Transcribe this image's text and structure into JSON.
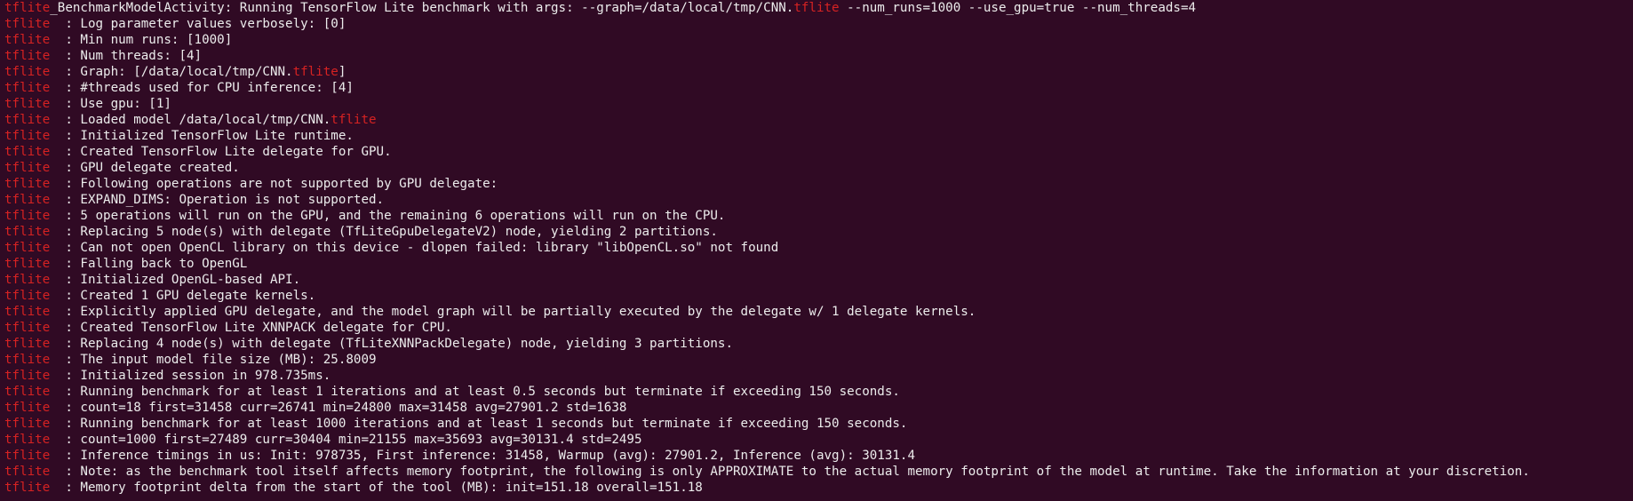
{
  "terminal": {
    "tag": "tflite",
    "first_line": {
      "tag": "tflite",
      "text": "_BenchmarkModelActivity: Running TensorFlow Lite benchmark with args: --graph=/data/local/tmp/CNN.",
      "tag_mid": "tflite",
      "tail": " --num_runs=1000 --use_gpu=true --num_threads=4"
    },
    "lines": [
      {
        "text": "  : Log parameter values verbosely: [0]"
      },
      {
        "text": "  : Min num runs: [1000]"
      },
      {
        "text": "  : Num threads: [4]"
      },
      {
        "text": "  : Graph: [/data/local/tmp/CNN.",
        "mid": "tflite",
        "tail": "]"
      },
      {
        "text": "  : #threads used for CPU inference: [4]"
      },
      {
        "text": "  : Use gpu: [1]"
      },
      {
        "text": "  : Loaded model /data/local/tmp/CNN.",
        "mid": "tflite",
        "tail": ""
      },
      {
        "text": "  : Initialized TensorFlow Lite runtime."
      },
      {
        "text": "  : Created TensorFlow Lite delegate for GPU."
      },
      {
        "text": "  : GPU delegate created."
      },
      {
        "text": "  : Following operations are not supported by GPU delegate:"
      },
      {
        "text": "  : EXPAND_DIMS: Operation is not supported."
      },
      {
        "text": "  : 5 operations will run on the GPU, and the remaining 6 operations will run on the CPU."
      },
      {
        "text": "  : Replacing 5 node(s) with delegate (TfLiteGpuDelegateV2) node, yielding 2 partitions."
      },
      {
        "text": "  : Can not open OpenCL library on this device - dlopen failed: library \"libOpenCL.so\" not found"
      },
      {
        "text": "  : Falling back to OpenGL"
      },
      {
        "text": "  : Initialized OpenGL-based API."
      },
      {
        "text": "  : Created 1 GPU delegate kernels."
      },
      {
        "text": "  : Explicitly applied GPU delegate, and the model graph will be partially executed by the delegate w/ 1 delegate kernels."
      },
      {
        "text": "  : Created TensorFlow Lite XNNPACK delegate for CPU."
      },
      {
        "text": "  : Replacing 4 node(s) with delegate (TfLiteXNNPackDelegate) node, yielding 3 partitions."
      },
      {
        "text": "  : The input model file size (MB): 25.8009"
      },
      {
        "text": "  : Initialized session in 978.735ms."
      },
      {
        "text": "  : Running benchmark for at least 1 iterations and at least 0.5 seconds but terminate if exceeding 150 seconds."
      },
      {
        "text": "  : count=18 first=31458 curr=26741 min=24800 max=31458 avg=27901.2 std=1638"
      },
      {
        "text": "  : Running benchmark for at least 1000 iterations and at least 1 seconds but terminate if exceeding 150 seconds."
      },
      {
        "text": "  : count=1000 first=27489 curr=30404 min=21155 max=35693 avg=30131.4 std=2495"
      },
      {
        "text": "  : Inference timings in us: Init: 978735, First inference: 31458, Warmup (avg): 27901.2, Inference (avg): 30131.4"
      },
      {
        "text": "  : Note: as the benchmark tool itself affects memory footprint, the following is only APPROXIMATE to the actual memory footprint of the model at runtime. Take the information at your discretion."
      },
      {
        "text": "  : Memory footprint delta from the start of the tool (MB): init=151.18 overall=151.18"
      }
    ]
  },
  "colors": {
    "background": "#300a24",
    "tag": "#d62222",
    "text": "#ececec"
  }
}
